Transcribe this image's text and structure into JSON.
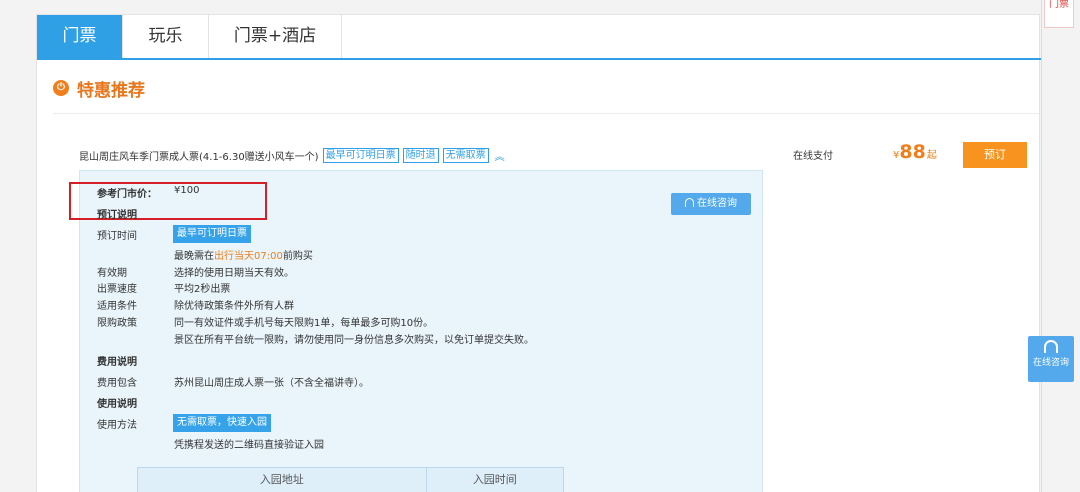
{
  "tabs": [
    "门票",
    "玩乐",
    "门票+酒店"
  ],
  "section": {
    "title": "特惠推荐"
  },
  "product": {
    "name": "昆山周庄风车季门票成人票(4.1-6.30赠送小风车一个)",
    "tags": [
      "最早可订明日票",
      "随时退",
      "无需取票"
    ],
    "expand_icon": "double-chevron-up-icon",
    "pay_label": "在线支付",
    "price_symbol": "¥",
    "price": "88",
    "price_suffix": "起",
    "book_label": "预订"
  },
  "detail": {
    "consult_label": "在线咨询",
    "market_price_label": "参考门市价：",
    "market_price": "¥100",
    "booking_heading": "预订说明",
    "booking_time_label": "预订时间",
    "booking_time_badge": "最早可订明日票",
    "booking_time_note_pre": "最晚需在",
    "booking_time_note_hl": "出行当天07:00",
    "booking_time_note_post": "前购买",
    "validity_label": "有效期",
    "validity_value": "选择的使用日期当天有效。",
    "speed_label": "出票速度",
    "speed_value": "平均2秒出票",
    "conditions_label": "适用条件",
    "conditions_value": "除优待政策条件外所有人群",
    "limit_label": "限购政策",
    "limit_value_1": "同一有效证件或手机号每天限购1单，每单最多可购10份。",
    "limit_value_2": "景区在所有平台统一限购，请勿使用同一身份信息多次购买，以免订单提交失败。",
    "fee_heading": "费用说明",
    "fee_include_label": "费用包含",
    "fee_include_value": "苏州昆山周庄成人票一张（不含全福讲寺）。",
    "usage_heading": "使用说明",
    "usage_method_label": "使用方法",
    "usage_method_badge": "无需取票，快速入园",
    "usage_method_value": "凭携程发送的二维码直接验证入园",
    "table_headers": [
      "入园地址",
      "入园时间"
    ]
  },
  "side": {
    "tab_text": "门票",
    "float_consult": "在线咨询"
  },
  "colors": {
    "accent_blue": "#2f9fe6",
    "accent_orange": "#f07e1a",
    "highlight_red": "#d51f26"
  }
}
